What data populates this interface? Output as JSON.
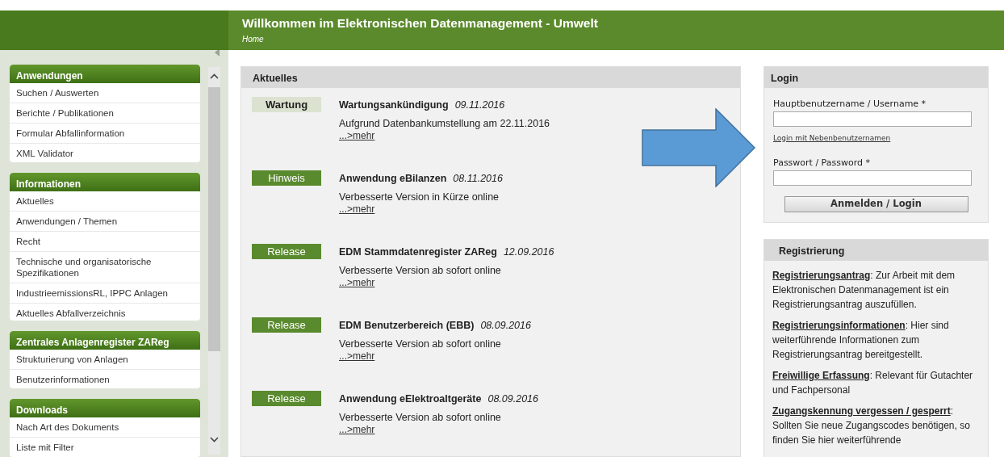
{
  "header": {
    "title": "Willkommen im Elektronischen Datenmanagement - Umwelt",
    "breadcrumb": "Home"
  },
  "sidebar": {
    "sections": [
      {
        "title": "Anwendungen",
        "items": [
          {
            "label": "Suchen / Auswerten"
          },
          {
            "label": "Berichte / Publikationen"
          },
          {
            "label": "Formular Abfallinformation"
          },
          {
            "label": "XML Validator"
          }
        ]
      },
      {
        "title": "Informationen",
        "items": [
          {
            "label": "Aktuelles"
          },
          {
            "label": "Anwendungen / Themen"
          },
          {
            "label": "Recht"
          },
          {
            "label": "Technische und organisatorische Spezifikationen"
          },
          {
            "label": "IndustrieemissionsRL, IPPC Anlagen"
          },
          {
            "label": "Aktuelles Abfallverzeichnis"
          }
        ]
      },
      {
        "title": "Zentrales Anlagenregister ZAReg",
        "items": [
          {
            "label": "Strukturierung von Anlagen"
          },
          {
            "label": "Benutzerinformationen"
          }
        ]
      },
      {
        "title": "Downloads",
        "items": [
          {
            "label": "Nach Art des Dokuments"
          },
          {
            "label": "Liste mit Filter"
          }
        ]
      }
    ]
  },
  "news": {
    "title": "Aktuelles",
    "items": [
      {
        "kind": "maintenance",
        "category": "Wartung",
        "title": "Wartungsankündigung",
        "date": "09.11.2016",
        "text": "Aufgrund Datenbankumstellung am 22.11.2016",
        "link": "...>mehr"
      },
      {
        "kind": "notice",
        "category": "Hinweis",
        "title": "Anwendung eBilanzen",
        "date": "08.11.2016",
        "text": "Verbesserte Version in Kürze online",
        "link": "...>mehr"
      },
      {
        "kind": "release",
        "category": "Release",
        "title": "EDM Stammdatenregister ZAReg",
        "date": "12.09.2016",
        "text": "Verbesserte Version ab sofort online",
        "link": "...>mehr"
      },
      {
        "kind": "release",
        "category": "Release",
        "title": "EDM Benutzerbereich (EBB)",
        "date": "08.09.2016",
        "text": "Verbesserte Version ab sofort online",
        "link": "...>mehr"
      },
      {
        "kind": "release",
        "category": "Release",
        "title": "Anwendung eElektroaltgeräte",
        "date": "08.09.2016",
        "text": "Verbesserte Version ab sofort online",
        "link": "...>mehr"
      }
    ]
  },
  "login": {
    "title": "Login",
    "username_label": "Hauptbenutzername / Username *",
    "secondary_link": "Login mit Nebenbenutzernamen",
    "password_label": "Passwort / Password *",
    "button": "Anmelden / Login"
  },
  "registration": {
    "title": "Registrierung",
    "paragraphs": [
      {
        "link": "Registrierungsantrag",
        "text": ": Zur Arbeit mit dem Elektronischen Datenmanagement ist ein Registrierungsantrag auszufüllen."
      },
      {
        "link": "Registrierungsinformationen",
        "text": ": Hier sind weiterführende Informationen zum Registrierungsantrag bereitgestellt."
      },
      {
        "link": "Freiwillige Erfassung",
        "text": ": Relevant für Gutachter und Fachpersonal"
      },
      {
        "link": "Zugangskennung vergessen / gesperrt",
        "text": ": Sollten Sie neue Zugangscodes benötigen, so finden Sie hier weiterführende"
      }
    ]
  }
}
